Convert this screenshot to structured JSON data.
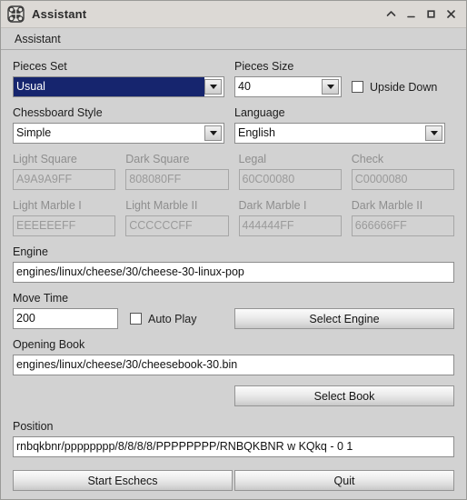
{
  "window": {
    "title": "Assistant",
    "icon": "chessboard-app-icon",
    "controls": [
      {
        "name": "shade-button",
        "glyph": "chevron-up"
      },
      {
        "name": "minimize-button",
        "glyph": "minimize"
      },
      {
        "name": "maximize-button",
        "glyph": "maximize"
      },
      {
        "name": "close-button",
        "glyph": "close"
      }
    ]
  },
  "menubar": {
    "items": [
      {
        "label": "Assistant"
      }
    ]
  },
  "form": {
    "pieces_set": {
      "label": "Pieces Set",
      "value": "Usual",
      "selected": true
    },
    "pieces_size": {
      "label": "Pieces Size",
      "value": "40"
    },
    "upside_down": {
      "label": "Upside Down",
      "checked": false
    },
    "chessboard_style": {
      "label": "Chessboard Style",
      "value": "Simple"
    },
    "language": {
      "label": "Language",
      "value": "English"
    },
    "colors": [
      {
        "label": "Light Square",
        "value": "A9A9A9FF",
        "disabled": true
      },
      {
        "label": "Dark Square",
        "value": "808080FF",
        "disabled": true
      },
      {
        "label": "Legal",
        "value": "60C00080",
        "disabled": true
      },
      {
        "label": "Check",
        "value": "C0000080",
        "disabled": true
      },
      {
        "label": "Light Marble I",
        "value": "EEEEEEFF",
        "disabled": true
      },
      {
        "label": "Light Marble II",
        "value": "CCCCCCFF",
        "disabled": true
      },
      {
        "label": "Dark Marble I",
        "value": "444444FF",
        "disabled": true
      },
      {
        "label": "Dark Marble II",
        "value": "666666FF",
        "disabled": true
      }
    ],
    "engine": {
      "label": "Engine",
      "value": "engines/linux/cheese/30/cheese-30-linux-pop"
    },
    "move_time": {
      "label": "Move Time",
      "value": "200"
    },
    "auto_play": {
      "label": "Auto Play",
      "checked": false
    },
    "select_engine": {
      "label": "Select Engine"
    },
    "opening_book": {
      "label": "Opening Book",
      "value": "engines/linux/cheese/30/cheesebook-30.bin"
    },
    "select_book": {
      "label": "Select Book"
    },
    "position": {
      "label": "Position",
      "value": "rnbqkbnr/pppppppp/8/8/8/8/PPPPPPPP/RNBQKBNR w KQkq - 0 1"
    },
    "start_button": {
      "label": "Start Eschecs"
    },
    "quit_button": {
      "label": "Quit"
    }
  },
  "colors": {
    "window_bg": "#d2d2d2",
    "titlebar_bg": "#dcd9d5",
    "selection_bg": "#16256e",
    "field_bg": "#ffffff",
    "disabled_text": "#9a9a9a"
  }
}
